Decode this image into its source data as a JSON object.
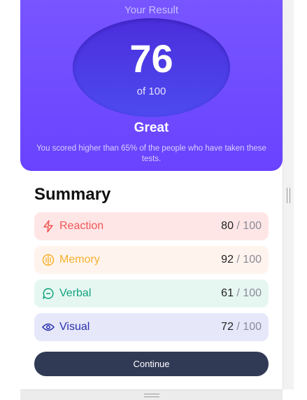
{
  "result": {
    "heading": "Your Result",
    "score": "76",
    "total": "of 100",
    "rating": "Great",
    "description": "You scored higher than 65% of the people who have taken these tests."
  },
  "summary": {
    "title": "Summary",
    "items": [
      {
        "label": "Reaction",
        "score": "80",
        "max": " / 100",
        "icon": "lightning-icon",
        "color": "#f05555"
      },
      {
        "label": "Memory",
        "score": "92",
        "max": " / 100",
        "icon": "brain-icon",
        "color": "#f5b12f"
      },
      {
        "label": "Verbal",
        "score": "61",
        "max": " / 100",
        "icon": "chat-icon",
        "color": "#12a37c"
      },
      {
        "label": "Visual",
        "score": "72",
        "max": " / 100",
        "icon": "eye-icon",
        "color": "#2a2fae"
      }
    ]
  },
  "actions": {
    "continue_label": "Continue"
  },
  "colors": {
    "accent": "#6943ff",
    "button": "#303a55"
  }
}
